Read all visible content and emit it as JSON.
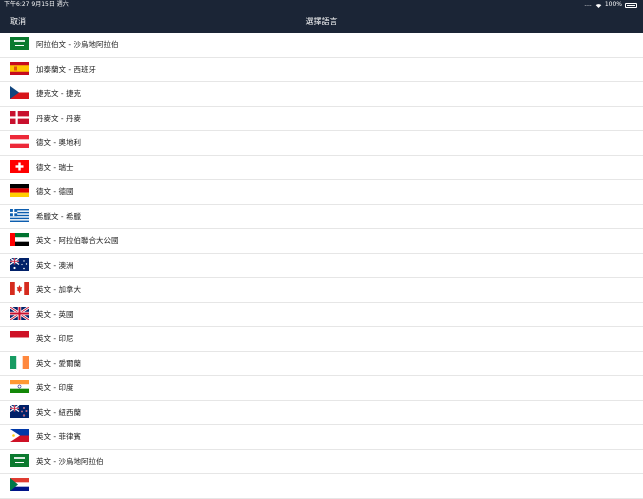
{
  "status": {
    "time": "下午6:27",
    "date": "9月15日 週六",
    "signal": "....",
    "battery": "100%"
  },
  "nav": {
    "cancel": "取消",
    "title": "選擇語言"
  },
  "languages": [
    {
      "label": "阿拉伯文 - 沙烏地阿拉伯",
      "flag": "saudi-arabia"
    },
    {
      "label": "加泰蘭文 - 西班牙",
      "flag": "spain"
    },
    {
      "label": "捷克文 - 捷克",
      "flag": "czech"
    },
    {
      "label": "丹麥文 - 丹麥",
      "flag": "denmark"
    },
    {
      "label": "德文 - 奧地利",
      "flag": "austria"
    },
    {
      "label": "德文 - 瑞士",
      "flag": "switzerland"
    },
    {
      "label": "德文 - 德國",
      "flag": "germany"
    },
    {
      "label": "希臘文 - 希臘",
      "flag": "greece"
    },
    {
      "label": "英文 - 阿拉伯聯合大公國",
      "flag": "uae"
    },
    {
      "label": "英文 - 澳洲",
      "flag": "australia"
    },
    {
      "label": "英文 - 加拿大",
      "flag": "canada"
    },
    {
      "label": "英文 - 英國",
      "flag": "uk"
    },
    {
      "label": "英文 - 印尼",
      "flag": "indonesia"
    },
    {
      "label": "英文 - 愛爾蘭",
      "flag": "ireland"
    },
    {
      "label": "英文 - 印度",
      "flag": "india"
    },
    {
      "label": "英文 - 紐西蘭",
      "flag": "new-zealand"
    },
    {
      "label": "英文 - 菲律賓",
      "flag": "philippines"
    },
    {
      "label": "英文 - 沙烏地阿拉伯",
      "flag": "saudi-arabia"
    },
    {
      "label": "",
      "flag": "south-africa"
    }
  ],
  "colors": {
    "nav_bg": "#1b2536",
    "nav_text": "#ffffff",
    "separator": "#e6e6e6"
  }
}
